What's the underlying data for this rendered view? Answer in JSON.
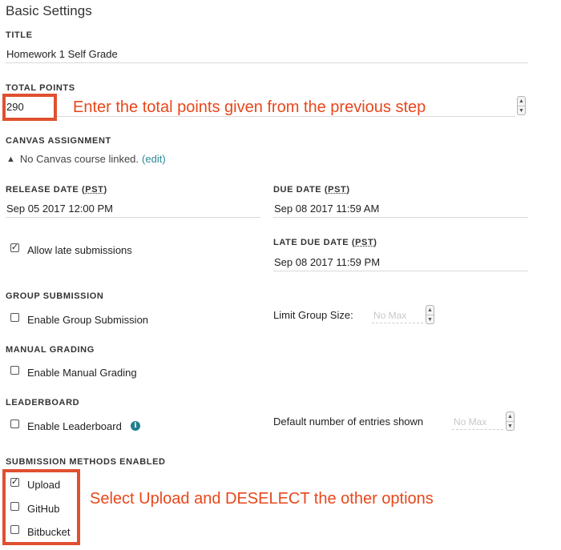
{
  "section_title": "Basic Settings",
  "title_field": {
    "label": "TITLE",
    "value": "Homework 1 Self Grade"
  },
  "total_points": {
    "label": "TOTAL POINTS",
    "value": "290"
  },
  "canvas": {
    "label": "CANVAS ASSIGNMENT",
    "text": "No Canvas course linked.",
    "edit_link": "(edit)"
  },
  "release_date": {
    "label_prefix": "RELEASE DATE (",
    "tz": "PST",
    "label_suffix": ")",
    "value": "Sep 05 2017 12:00 PM"
  },
  "due_date": {
    "label_prefix": "DUE DATE (",
    "tz": "PST",
    "label_suffix": ")",
    "value": "Sep 08 2017 11:59 AM"
  },
  "late_due_date": {
    "label_prefix": "LATE DUE DATE (",
    "tz": "PST",
    "label_suffix": ")",
    "value": "Sep 08 2017 11:59 PM"
  },
  "allow_late": {
    "label": "Allow late submissions",
    "checked": true,
    "check_glyph": "✓"
  },
  "group_submission": {
    "heading": "GROUP SUBMISSION",
    "checkbox_label": "Enable Group Submission",
    "limit_label": "Limit Group Size:",
    "limit_placeholder": "No Max"
  },
  "manual_grading": {
    "heading": "MANUAL GRADING",
    "checkbox_label": "Enable Manual Grading"
  },
  "leaderboard": {
    "heading": "LEADERBOARD",
    "checkbox_label": "Enable Leaderboard",
    "info_glyph": "i",
    "entries_label": "Default number of entries shown",
    "entries_placeholder": "No Max"
  },
  "submission_methods": {
    "heading": "SUBMISSION METHODS ENABLED",
    "upload": {
      "label": "Upload",
      "checked": true,
      "check_glyph": "✓"
    },
    "github": {
      "label": "GitHub",
      "checked": false
    },
    "bitbucket": {
      "label": "Bitbucket",
      "checked": false
    }
  },
  "annotations": {
    "points_instruction": "Enter the total points given from the previous step",
    "methods_instruction": "Select Upload and DESELECT the other options"
  },
  "glyphs": {
    "up": "▲",
    "down": "▼",
    "warning": "▲"
  },
  "colors": {
    "annotation": "#e8471b",
    "annotation_box": "#e05030",
    "link": "#2b8a99",
    "info": "#1f7f8c"
  }
}
